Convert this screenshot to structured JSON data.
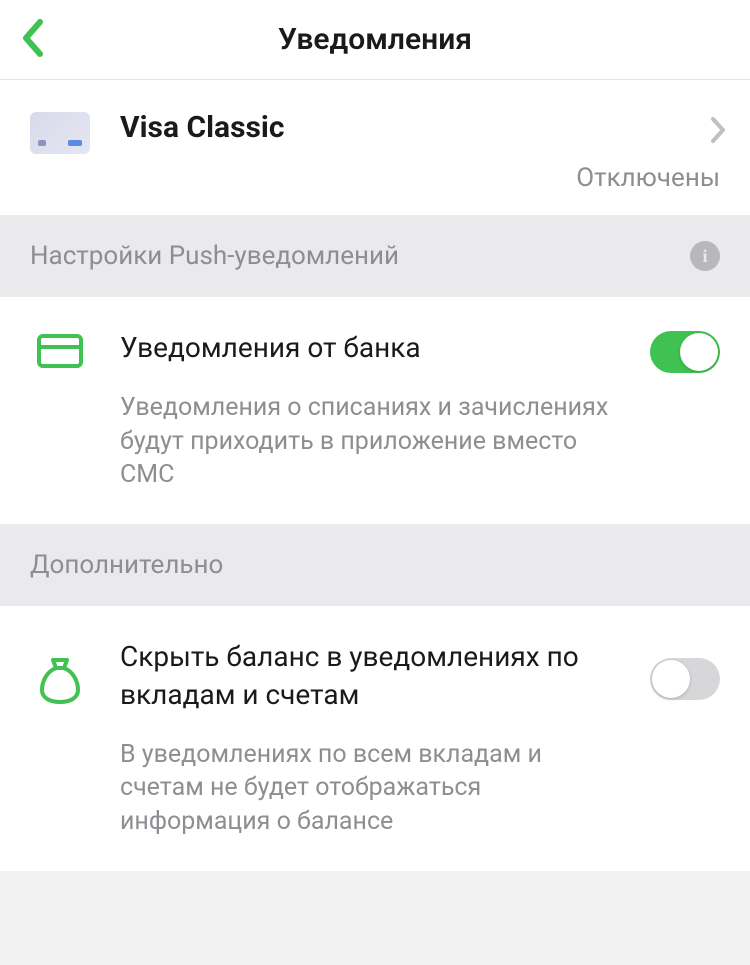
{
  "header": {
    "title": "Уведомления"
  },
  "card": {
    "name": "Visa Classic",
    "status": "Отключены"
  },
  "push_section": {
    "title": "Настройки Push-уведомлений"
  },
  "bank_notifications": {
    "title": "Уведомления от банка",
    "description": "Уведомления о списаниях и зачислениях будут приходить в приложение вместо СМС",
    "enabled": true
  },
  "additional_section": {
    "title": "Дополнительно"
  },
  "hide_balance": {
    "title": "Скрыть баланс в уведомлениях по вкладам и счетам",
    "description": "В уведомлениях по всем вкладам и счетам не будет отображаться информация о балансе",
    "enabled": false
  }
}
